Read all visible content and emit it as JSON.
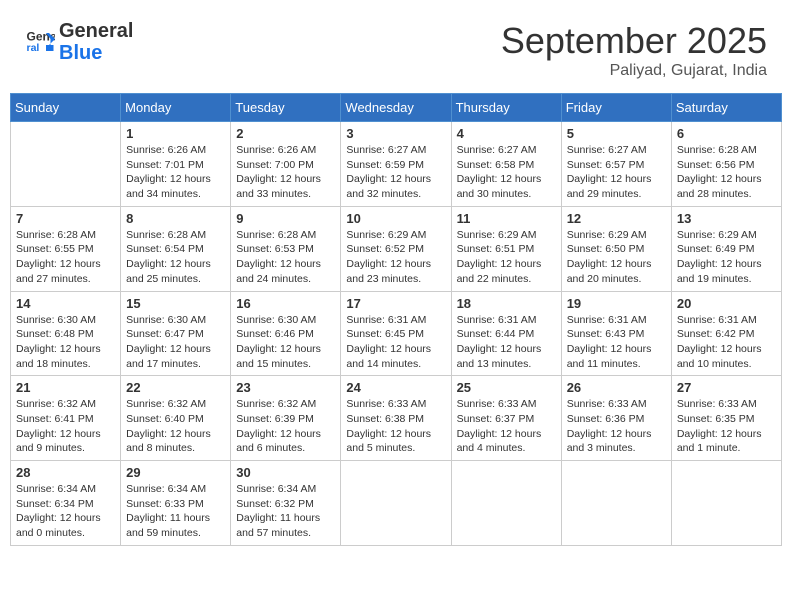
{
  "header": {
    "logo_line1": "General",
    "logo_line2": "Blue",
    "month": "September 2025",
    "location": "Paliyad, Gujarat, India"
  },
  "days_of_week": [
    "Sunday",
    "Monday",
    "Tuesday",
    "Wednesday",
    "Thursday",
    "Friday",
    "Saturday"
  ],
  "weeks": [
    [
      {
        "day": "",
        "info": ""
      },
      {
        "day": "1",
        "info": "Sunrise: 6:26 AM\nSunset: 7:01 PM\nDaylight: 12 hours\nand 34 minutes."
      },
      {
        "day": "2",
        "info": "Sunrise: 6:26 AM\nSunset: 7:00 PM\nDaylight: 12 hours\nand 33 minutes."
      },
      {
        "day": "3",
        "info": "Sunrise: 6:27 AM\nSunset: 6:59 PM\nDaylight: 12 hours\nand 32 minutes."
      },
      {
        "day": "4",
        "info": "Sunrise: 6:27 AM\nSunset: 6:58 PM\nDaylight: 12 hours\nand 30 minutes."
      },
      {
        "day": "5",
        "info": "Sunrise: 6:27 AM\nSunset: 6:57 PM\nDaylight: 12 hours\nand 29 minutes."
      },
      {
        "day": "6",
        "info": "Sunrise: 6:28 AM\nSunset: 6:56 PM\nDaylight: 12 hours\nand 28 minutes."
      }
    ],
    [
      {
        "day": "7",
        "info": "Sunrise: 6:28 AM\nSunset: 6:55 PM\nDaylight: 12 hours\nand 27 minutes."
      },
      {
        "day": "8",
        "info": "Sunrise: 6:28 AM\nSunset: 6:54 PM\nDaylight: 12 hours\nand 25 minutes."
      },
      {
        "day": "9",
        "info": "Sunrise: 6:28 AM\nSunset: 6:53 PM\nDaylight: 12 hours\nand 24 minutes."
      },
      {
        "day": "10",
        "info": "Sunrise: 6:29 AM\nSunset: 6:52 PM\nDaylight: 12 hours\nand 23 minutes."
      },
      {
        "day": "11",
        "info": "Sunrise: 6:29 AM\nSunset: 6:51 PM\nDaylight: 12 hours\nand 22 minutes."
      },
      {
        "day": "12",
        "info": "Sunrise: 6:29 AM\nSunset: 6:50 PM\nDaylight: 12 hours\nand 20 minutes."
      },
      {
        "day": "13",
        "info": "Sunrise: 6:29 AM\nSunset: 6:49 PM\nDaylight: 12 hours\nand 19 minutes."
      }
    ],
    [
      {
        "day": "14",
        "info": "Sunrise: 6:30 AM\nSunset: 6:48 PM\nDaylight: 12 hours\nand 18 minutes."
      },
      {
        "day": "15",
        "info": "Sunrise: 6:30 AM\nSunset: 6:47 PM\nDaylight: 12 hours\nand 17 minutes."
      },
      {
        "day": "16",
        "info": "Sunrise: 6:30 AM\nSunset: 6:46 PM\nDaylight: 12 hours\nand 15 minutes."
      },
      {
        "day": "17",
        "info": "Sunrise: 6:31 AM\nSunset: 6:45 PM\nDaylight: 12 hours\nand 14 minutes."
      },
      {
        "day": "18",
        "info": "Sunrise: 6:31 AM\nSunset: 6:44 PM\nDaylight: 12 hours\nand 13 minutes."
      },
      {
        "day": "19",
        "info": "Sunrise: 6:31 AM\nSunset: 6:43 PM\nDaylight: 12 hours\nand 11 minutes."
      },
      {
        "day": "20",
        "info": "Sunrise: 6:31 AM\nSunset: 6:42 PM\nDaylight: 12 hours\nand 10 minutes."
      }
    ],
    [
      {
        "day": "21",
        "info": "Sunrise: 6:32 AM\nSunset: 6:41 PM\nDaylight: 12 hours\nand 9 minutes."
      },
      {
        "day": "22",
        "info": "Sunrise: 6:32 AM\nSunset: 6:40 PM\nDaylight: 12 hours\nand 8 minutes."
      },
      {
        "day": "23",
        "info": "Sunrise: 6:32 AM\nSunset: 6:39 PM\nDaylight: 12 hours\nand 6 minutes."
      },
      {
        "day": "24",
        "info": "Sunrise: 6:33 AM\nSunset: 6:38 PM\nDaylight: 12 hours\nand 5 minutes."
      },
      {
        "day": "25",
        "info": "Sunrise: 6:33 AM\nSunset: 6:37 PM\nDaylight: 12 hours\nand 4 minutes."
      },
      {
        "day": "26",
        "info": "Sunrise: 6:33 AM\nSunset: 6:36 PM\nDaylight: 12 hours\nand 3 minutes."
      },
      {
        "day": "27",
        "info": "Sunrise: 6:33 AM\nSunset: 6:35 PM\nDaylight: 12 hours\nand 1 minute."
      }
    ],
    [
      {
        "day": "28",
        "info": "Sunrise: 6:34 AM\nSunset: 6:34 PM\nDaylight: 12 hours\nand 0 minutes."
      },
      {
        "day": "29",
        "info": "Sunrise: 6:34 AM\nSunset: 6:33 PM\nDaylight: 11 hours\nand 59 minutes."
      },
      {
        "day": "30",
        "info": "Sunrise: 6:34 AM\nSunset: 6:32 PM\nDaylight: 11 hours\nand 57 minutes."
      },
      {
        "day": "",
        "info": ""
      },
      {
        "day": "",
        "info": ""
      },
      {
        "day": "",
        "info": ""
      },
      {
        "day": "",
        "info": ""
      }
    ]
  ]
}
